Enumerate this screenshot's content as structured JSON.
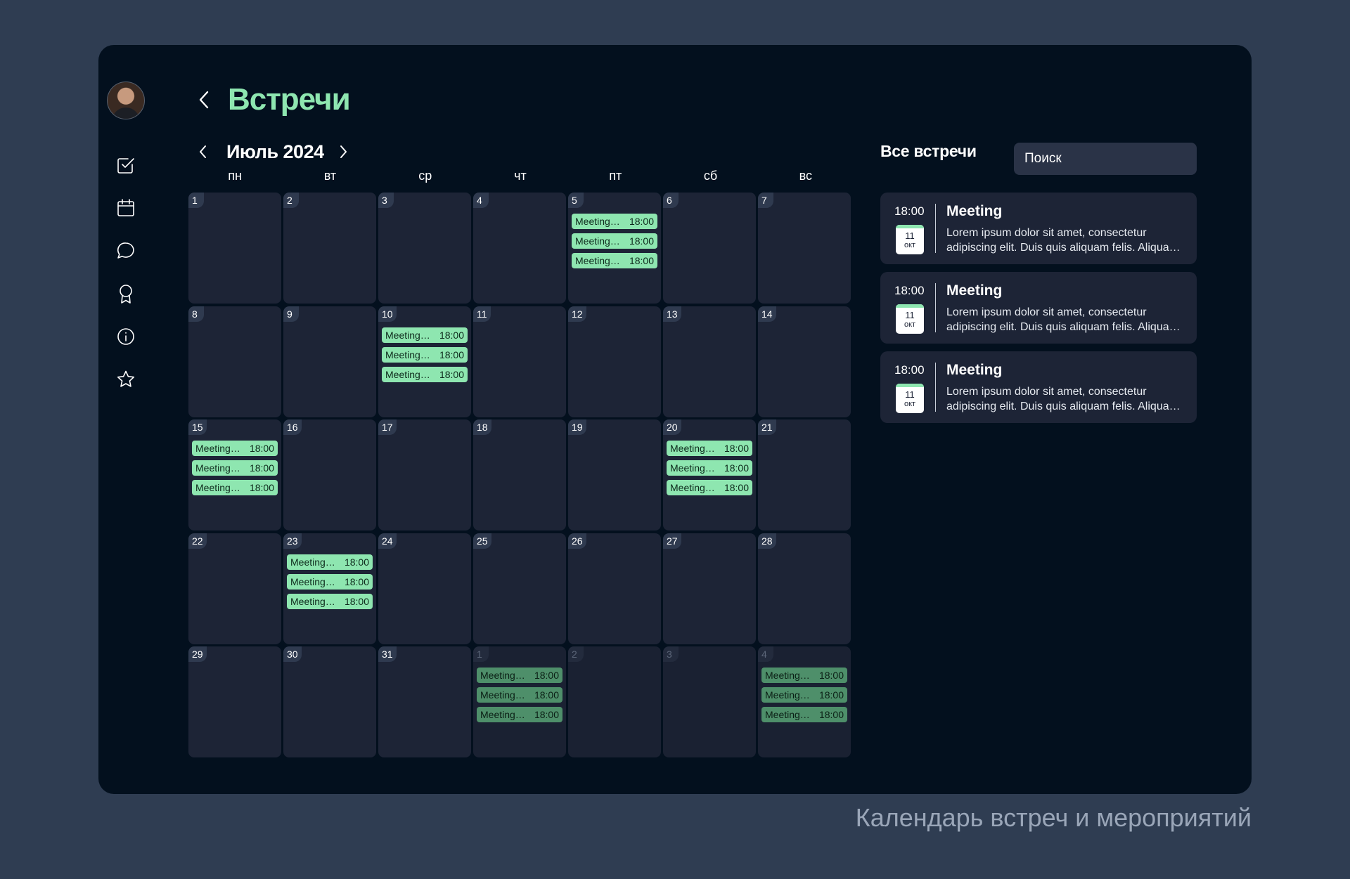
{
  "page": {
    "title": "Встречи",
    "caption": "Календарь встреч и мероприятий"
  },
  "calendar": {
    "month_label": "Июль 2024",
    "weekdays": [
      "пн",
      "вт",
      "ср",
      "чт",
      "пт",
      "сб",
      "вс"
    ],
    "days": [
      {
        "n": "1",
        "muted": false,
        "events": []
      },
      {
        "n": "2",
        "muted": false,
        "events": []
      },
      {
        "n": "3",
        "muted": false,
        "events": []
      },
      {
        "n": "4",
        "muted": false,
        "events": []
      },
      {
        "n": "5",
        "muted": false,
        "events": [
          {
            "title": "Meeting…",
            "time": "18:00"
          },
          {
            "title": "Meeting…",
            "time": "18:00"
          },
          {
            "title": "Meeting…",
            "time": "18:00"
          }
        ]
      },
      {
        "n": "6",
        "muted": false,
        "events": []
      },
      {
        "n": "7",
        "muted": false,
        "events": []
      },
      {
        "n": "8",
        "muted": false,
        "events": []
      },
      {
        "n": "9",
        "muted": false,
        "events": []
      },
      {
        "n": "10",
        "muted": false,
        "events": [
          {
            "title": "Meeting…",
            "time": "18:00"
          },
          {
            "title": "Meeting…",
            "time": "18:00"
          },
          {
            "title": "Meeting…",
            "time": "18:00"
          }
        ]
      },
      {
        "n": "11",
        "muted": false,
        "events": []
      },
      {
        "n": "12",
        "muted": false,
        "events": []
      },
      {
        "n": "13",
        "muted": false,
        "events": []
      },
      {
        "n": "14",
        "muted": false,
        "events": []
      },
      {
        "n": "15",
        "muted": false,
        "events": [
          {
            "title": "Meeting…",
            "time": "18:00"
          },
          {
            "title": "Meeting…",
            "time": "18:00"
          },
          {
            "title": "Meeting…",
            "time": "18:00"
          }
        ]
      },
      {
        "n": "16",
        "muted": false,
        "events": []
      },
      {
        "n": "17",
        "muted": false,
        "events": []
      },
      {
        "n": "18",
        "muted": false,
        "events": []
      },
      {
        "n": "19",
        "muted": false,
        "events": []
      },
      {
        "n": "20",
        "muted": false,
        "events": [
          {
            "title": "Meeting…",
            "time": "18:00"
          },
          {
            "title": "Meeting…",
            "time": "18:00"
          },
          {
            "title": "Meeting…",
            "time": "18:00"
          }
        ]
      },
      {
        "n": "21",
        "muted": false,
        "events": []
      },
      {
        "n": "22",
        "muted": false,
        "events": []
      },
      {
        "n": "23",
        "muted": false,
        "events": [
          {
            "title": "Meeting…",
            "time": "18:00"
          },
          {
            "title": "Meeting…",
            "time": "18:00"
          },
          {
            "title": "Meeting…",
            "time": "18:00"
          }
        ]
      },
      {
        "n": "24",
        "muted": false,
        "events": []
      },
      {
        "n": "25",
        "muted": false,
        "events": []
      },
      {
        "n": "26",
        "muted": false,
        "events": []
      },
      {
        "n": "27",
        "muted": false,
        "events": []
      },
      {
        "n": "28",
        "muted": false,
        "events": []
      },
      {
        "n": "29",
        "muted": false,
        "events": []
      },
      {
        "n": "30",
        "muted": false,
        "events": []
      },
      {
        "n": "31",
        "muted": false,
        "events": []
      },
      {
        "n": "1",
        "muted": true,
        "events": [
          {
            "title": "Meeting…",
            "time": "18:00"
          },
          {
            "title": "Meeting…",
            "time": "18:00"
          },
          {
            "title": "Meeting…",
            "time": "18:00"
          }
        ]
      },
      {
        "n": "2",
        "muted": true,
        "events": []
      },
      {
        "n": "3",
        "muted": true,
        "events": []
      },
      {
        "n": "4",
        "muted": true,
        "events": [
          {
            "title": "Meeting…",
            "time": "18:00"
          },
          {
            "title": "Meeting…",
            "time": "18:00"
          },
          {
            "title": "Meeting…",
            "time": "18:00"
          }
        ]
      }
    ]
  },
  "sidebar_nav": {
    "icons": [
      "checkbox-icon",
      "calendar-icon",
      "chat-icon",
      "award-icon",
      "info-icon",
      "star-icon"
    ]
  },
  "meetings_panel": {
    "title": "Все встречи",
    "search_placeholder": "Поиск",
    "items": [
      {
        "time": "18:00",
        "day": "11",
        "month": "окт",
        "title": "Meeting",
        "description": "Lorem ipsum dolor sit amet, consectetur adipiscing elit. Duis quis aliquam felis. Aliquam erat volutpat."
      },
      {
        "time": "18:00",
        "day": "11",
        "month": "окт",
        "title": "Meeting",
        "description": "Lorem ipsum dolor sit amet, consectetur adipiscing elit. Duis quis aliquam felis. Aliquam erat volutpat."
      },
      {
        "time": "18:00",
        "day": "11",
        "month": "окт",
        "title": "Meeting",
        "description": "Lorem ipsum dolor sit amet, consectetur adipiscing elit. Duis quis aliquam felis. Aliquam erat volutpat."
      }
    ]
  },
  "colors": {
    "accent": "#8ee6b0",
    "panel": "#03101e",
    "cell": "#1d2436",
    "background": "#2f3d52"
  }
}
